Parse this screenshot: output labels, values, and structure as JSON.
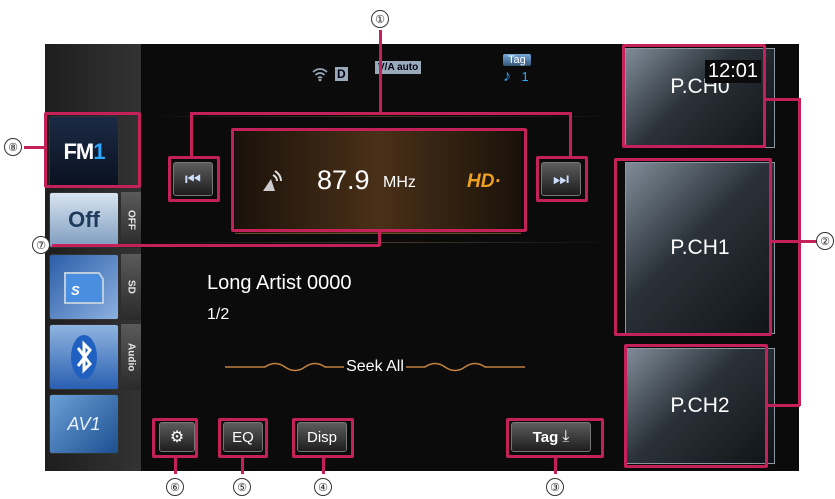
{
  "sources": {
    "fm_label": "FM",
    "fm_num": "1",
    "off_label": "Off",
    "off_tab": "OFF",
    "sd_tab": "SD",
    "audio_tab": "Audio",
    "av_label": "AV1"
  },
  "status": {
    "d_badge": "D",
    "va_badge": "V/A auto",
    "tag_label": "Tag",
    "tag_count": "1",
    "clock": "12:01"
  },
  "tuner": {
    "frequency": "87.9",
    "unit": "MHz",
    "hd_label": "HD"
  },
  "track": {
    "artist": "Long Artist 0000",
    "page": "1/2",
    "seek_mode": "Seek All"
  },
  "presets": [
    "P.CH0",
    "P.CH1",
    "P.CH2"
  ],
  "bottom_buttons": {
    "eq": "EQ",
    "disp": "Disp",
    "tag": "Tag"
  },
  "callouts": [
    "①",
    "②",
    "③",
    "④",
    "⑤",
    "⑥",
    "⑦",
    "⑧"
  ],
  "colors": {
    "annotation": "#c4205a",
    "accent_blue": "#2ea8ff",
    "hd_orange": "#f0a020"
  }
}
